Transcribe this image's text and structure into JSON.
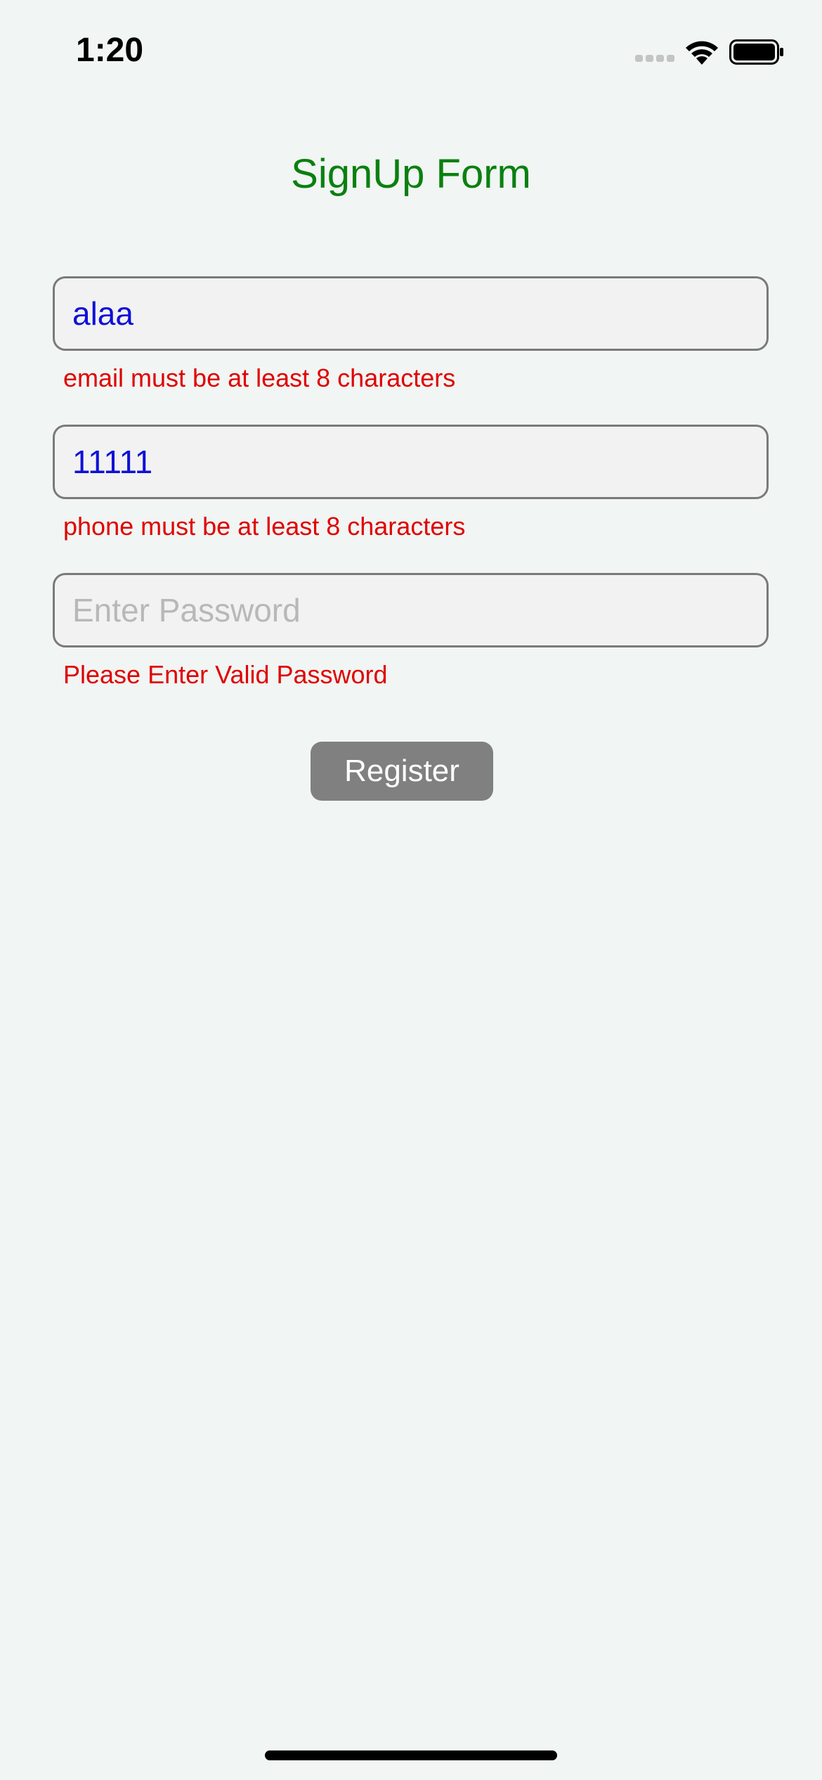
{
  "status_bar": {
    "time": "1:20",
    "signal_icon": "signal-dots-icon",
    "wifi_icon": "wifi-icon",
    "battery_icon": "battery-icon"
  },
  "form": {
    "title": "SignUp Form",
    "email": {
      "value": "alaa",
      "error": "email must be at least 8 characters"
    },
    "phone": {
      "value": "11111",
      "error": "phone must be at least 8 characters"
    },
    "password": {
      "value": "",
      "placeholder": "Enter Password",
      "error": "Please Enter Valid Password"
    },
    "register_label": "Register"
  },
  "colors": {
    "background": "#f1f5f3",
    "title": "#0a8010",
    "input_text": "#1010d8",
    "error": "#e00000",
    "button": "#808080"
  }
}
